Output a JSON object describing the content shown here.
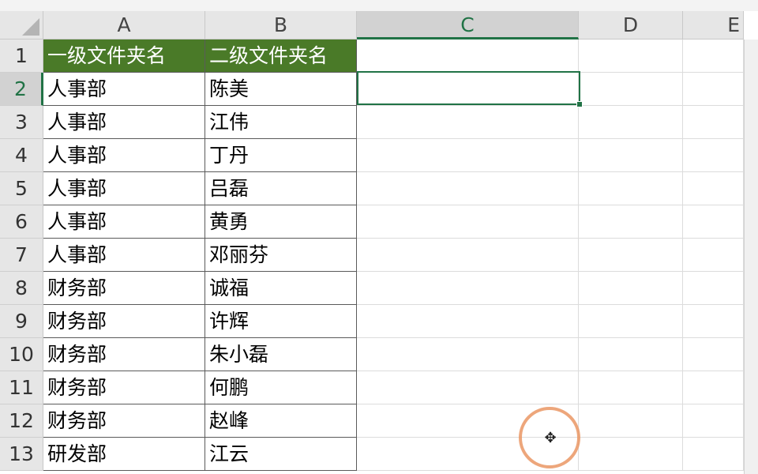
{
  "columns": [
    {
      "label": "A"
    },
    {
      "label": "B"
    },
    {
      "label": "C"
    },
    {
      "label": "D"
    },
    {
      "label": "E"
    }
  ],
  "rows": [
    {
      "num": "1",
      "a": "一级文件夹名",
      "b": "二级文件夹名"
    },
    {
      "num": "2",
      "a": "人事部",
      "b": "陈美"
    },
    {
      "num": "3",
      "a": "人事部",
      "b": "江伟"
    },
    {
      "num": "4",
      "a": "人事部",
      "b": "丁丹"
    },
    {
      "num": "5",
      "a": "人事部",
      "b": "吕磊"
    },
    {
      "num": "6",
      "a": "人事部",
      "b": "黄勇"
    },
    {
      "num": "7",
      "a": "人事部",
      "b": "邓丽芬"
    },
    {
      "num": "8",
      "a": "财务部",
      "b": "诚福"
    },
    {
      "num": "9",
      "a": "财务部",
      "b": "许辉"
    },
    {
      "num": "10",
      "a": "财务部",
      "b": "朱小磊"
    },
    {
      "num": "11",
      "a": "财务部",
      "b": "何鹏"
    },
    {
      "num": "12",
      "a": "财务部",
      "b": "赵峰"
    },
    {
      "num": "13",
      "a": "研发部",
      "b": "江云"
    }
  ],
  "active_cell": {
    "column": "C",
    "row": "2"
  },
  "colors": {
    "header_fill": "#4a7a28",
    "accent": "#217346",
    "cursor_ring": "#ea9664"
  },
  "icons": {
    "cursor": "plus-cursor-icon"
  }
}
